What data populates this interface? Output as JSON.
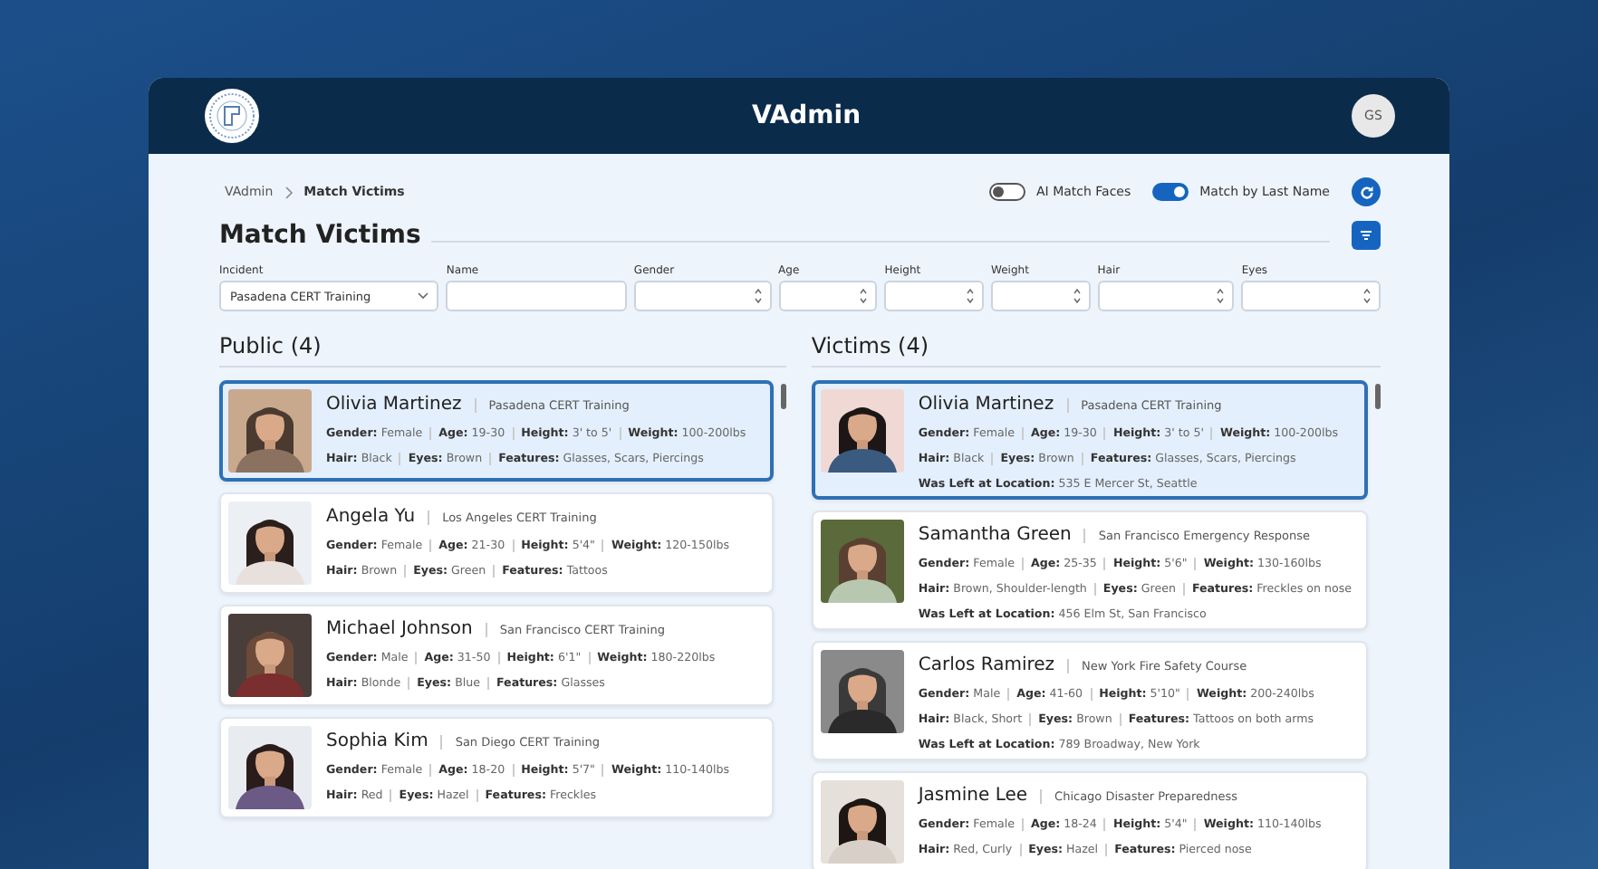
{
  "header": {
    "title": "VAdmin",
    "avatar": "GS"
  },
  "breadcrumb": [
    {
      "label": "VAdmin",
      "current": false
    },
    {
      "label": "Match Victims",
      "current": true
    }
  ],
  "toggles": [
    {
      "label": "AI Match Faces",
      "on": false
    },
    {
      "label": "Match by Last Name",
      "on": true
    }
  ],
  "page_title": "Match Victims",
  "filters": [
    {
      "label": "Incident",
      "kind": "select",
      "value": "Pasadena CERT Training"
    },
    {
      "label": "Name",
      "kind": "text"
    },
    {
      "label": "Gender",
      "kind": "spin"
    },
    {
      "label": "Age",
      "kind": "spin"
    },
    {
      "label": "Height",
      "kind": "spin"
    },
    {
      "label": "Weight",
      "kind": "spin"
    },
    {
      "label": "Hair",
      "kind": "spin"
    },
    {
      "label": "Eyes",
      "kind": "spin"
    }
  ],
  "panels": [
    {
      "title": "Public (4)",
      "cards": [
        {
          "name": "Olivia Martinez",
          "incident": "Pasadena CERT Training",
          "selected": true,
          "details": [
            [
              "**Gender:** Female",
              "**Age:** 19-30",
              "**Height:** 3' to 5'",
              "**Weight:** 100-200lbs"
            ],
            [
              "**Hair:** Black",
              "**Eyes:** Brown",
              "**Features:** Glasses, Scars, Piercings"
            ]
          ]
        },
        {
          "name": "Angela Yu",
          "incident": "Los Angeles CERT Training",
          "selected": false,
          "details": [
            [
              "**Gender:** Female",
              "**Age:** 21-30",
              "**Height:** 5'4\"",
              "**Weight:** 120-150lbs"
            ],
            [
              "**Hair:** Brown",
              "**Eyes:** Green",
              "**Features:** Tattoos"
            ]
          ]
        },
        {
          "name": "Michael Johnson",
          "incident": "San Francisco CERT Training",
          "selected": false,
          "details": [
            [
              "**Gender:** Male",
              "**Age:** 31-50",
              "**Height:** 6'1\"",
              "**Weight:** 180-220lbs"
            ],
            [
              "**Hair:** Blonde",
              "**Eyes:** Blue",
              "**Features:** Glasses"
            ]
          ]
        },
        {
          "name": "Sophia Kim",
          "incident": "San Diego CERT Training",
          "selected": false,
          "details": [
            [
              "**Gender:** Female",
              "**Age:** 18-20",
              "**Height:** 5'7\"",
              "**Weight:** 110-140lbs"
            ],
            [
              "**Hair:** Red",
              "**Eyes:** Hazel",
              "**Features:** Freckles"
            ]
          ]
        }
      ]
    },
    {
      "title": "Victims (4)",
      "cards": [
        {
          "name": "Olivia Martinez",
          "incident": "Pasadena CERT Training",
          "selected": true,
          "details": [
            [
              "**Gender:** Female",
              "**Age:** 19-30",
              "**Height:** 3' to 5'",
              "**Weight:** 100-200lbs"
            ],
            [
              "**Hair:** Black",
              "**Eyes:** Brown",
              "**Features:** Glasses, Scars, Piercings"
            ],
            [
              "**Was Left at Location:** 535 E Mercer St, Seattle"
            ]
          ]
        },
        {
          "name": "Samantha Green",
          "incident": "San Francisco Emergency Response",
          "selected": false,
          "details": [
            [
              "**Gender:** Female",
              "**Age:** 25-35",
              "**Height:** 5'6\"",
              "**Weight:** 130-160lbs"
            ],
            [
              "**Hair:** Brown, Shoulder-length",
              "**Eyes:** Green",
              "**Features:** Freckles on nose"
            ],
            [
              "**Was Left at Location:** 456 Elm St, San Francisco"
            ]
          ]
        },
        {
          "name": "Carlos Ramirez",
          "incident": "New York Fire Safety Course",
          "selected": false,
          "details": [
            [
              "**Gender:** Male",
              "**Age:** 41-60",
              "**Height:** 5'10\"",
              "**Weight:** 200-240lbs"
            ],
            [
              "**Hair:** Black, Short",
              "**Eyes:** Brown",
              "**Features:** Tattoos on both arms"
            ],
            [
              "**Was Left at Location:** 789 Broadway, New York"
            ]
          ]
        },
        {
          "name": "Jasmine Lee",
          "incident": "Chicago Disaster Preparedness",
          "selected": false,
          "details": [
            [
              "**Gender:** Female",
              "**Age:** 18-24",
              "**Height:** 5'4\"",
              "**Weight:** 110-140lbs"
            ],
            [
              "**Hair:** Red, Curly",
              "**Eyes:** Hazel",
              "**Features:** Pierced nose"
            ]
          ]
        }
      ]
    }
  ]
}
